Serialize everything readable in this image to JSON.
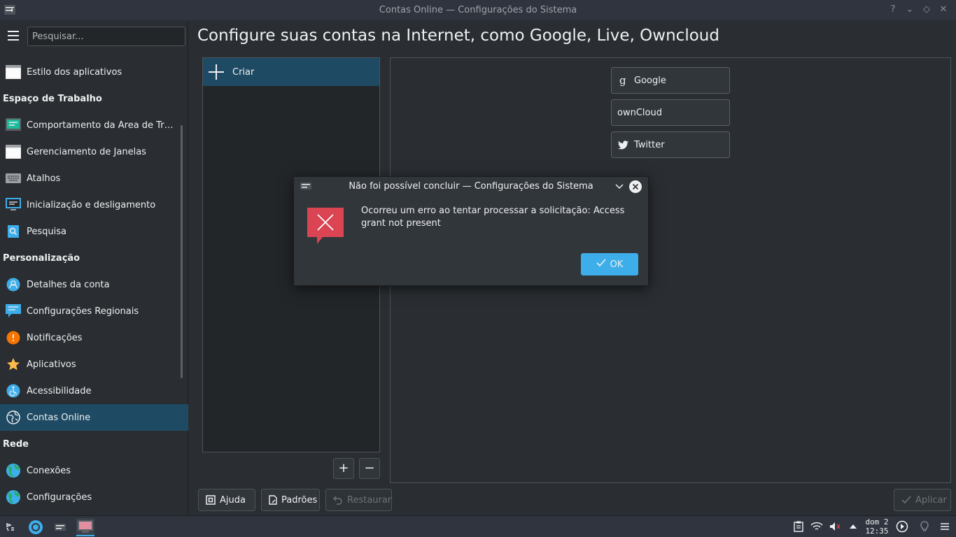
{
  "window": {
    "title": "Contas Online — Configurações do Sistema",
    "controls": [
      "?",
      "⌄",
      "◇",
      "✕"
    ]
  },
  "sidebar": {
    "search_placeholder": "Pesquisar...",
    "entries": [
      {
        "kind": "item",
        "label": "Estilo dos aplicativos",
        "icon": "window-icon",
        "active": false
      },
      {
        "kind": "category",
        "label": "Espaço de Trabalho"
      },
      {
        "kind": "item",
        "label": "Comportamento da Área de Trab...",
        "icon": "desktop-behavior-icon",
        "active": false
      },
      {
        "kind": "item",
        "label": "Gerenciamento de Janelas",
        "icon": "window-icon",
        "active": false
      },
      {
        "kind": "item",
        "label": "Atalhos",
        "icon": "keyboard-icon",
        "active": false
      },
      {
        "kind": "item",
        "label": "Inicialização e desligamento",
        "icon": "monitor-icon",
        "active": false
      },
      {
        "kind": "item",
        "label": "Pesquisa",
        "icon": "search-icon",
        "active": false
      },
      {
        "kind": "category",
        "label": "Personalização"
      },
      {
        "kind": "item",
        "label": "Detalhes da conta",
        "icon": "user-icon",
        "active": false
      },
      {
        "kind": "item",
        "label": "Configurações Regionais",
        "icon": "chat-flag-icon",
        "active": false
      },
      {
        "kind": "item",
        "label": "Notificações",
        "icon": "notification-icon",
        "active": false
      },
      {
        "kind": "item",
        "label": "Aplicativos",
        "icon": "star-icon",
        "active": false
      },
      {
        "kind": "item",
        "label": "Acessibilidade",
        "icon": "accessibility-icon",
        "active": false
      },
      {
        "kind": "item",
        "label": "Contas Online",
        "icon": "globe-icon",
        "active": true
      },
      {
        "kind": "category",
        "label": "Rede"
      },
      {
        "kind": "item",
        "label": "Conexões",
        "icon": "network-globe-icon",
        "active": false
      },
      {
        "kind": "item",
        "label": "Configurações",
        "icon": "network-globe-icon",
        "active": false
      }
    ]
  },
  "main": {
    "heading": "Configure suas contas na Internet, como Google, Live, Owncloud",
    "accounts_list": {
      "create_label": "Criar",
      "add_symbol": "+",
      "remove_symbol": "−"
    },
    "providers": [
      {
        "label": "Google",
        "icon": "google-icon"
      },
      {
        "label": "ownCloud",
        "icon": ""
      },
      {
        "label": "Twitter",
        "icon": "twitter-icon"
      }
    ]
  },
  "footer": {
    "help_label": "Ajuda",
    "defaults_label": "Padrões",
    "reset_label": "Restaurar",
    "apply_label": "Aplicar"
  },
  "dialog": {
    "title": "Não foi possível concluir — Configurações do Sistema",
    "message": "Ocorreu um erro ao tentar processar a solicitação: Access grant not present",
    "ok_label": "OK"
  },
  "taskbar": {
    "clock_day": "dom 2",
    "clock_time": "12:35"
  },
  "colors": {
    "accent": "#3daee9",
    "selection": "#1e4a63",
    "error": "#da4453",
    "background": "#2a2e32"
  }
}
